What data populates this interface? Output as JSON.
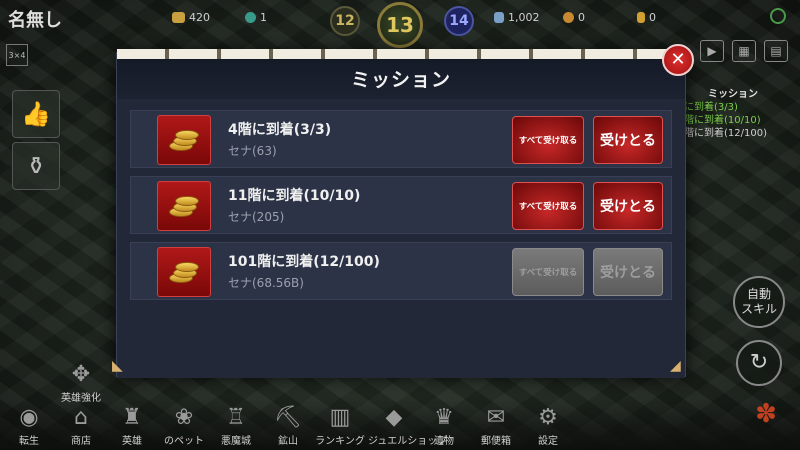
{
  "hud": {
    "player_name": "名無し",
    "gold": "420",
    "gems": "1",
    "floor_prev": "12",
    "floor_current": "13",
    "floor_next": "14",
    "hp": "1,002",
    "sun": "0",
    "crystal": "0"
  },
  "left": {
    "corner_label": "3×4"
  },
  "modal": {
    "title": "ミッション",
    "close_label": "✕",
    "missions": [
      {
        "name": "4階に到着(3/3)",
        "reward": "セナ(63)",
        "claim_all_label": "すべて受け取る",
        "claim_label": "受けとる",
        "enabled": true
      },
      {
        "name": "11階に到着(10/10)",
        "reward": "セナ(205)",
        "claim_all_label": "すべて受け取る",
        "claim_label": "受けとる",
        "enabled": true
      },
      {
        "name": "101階に到着(12/100)",
        "reward": "セナ(68.56B)",
        "claim_all_label": "すべて受け取る",
        "claim_label": "受けとる",
        "enabled": false
      }
    ]
  },
  "bg_mission": {
    "title": "ミッション",
    "line1": "に到着(3/3)",
    "line2": "階に到着(10/10)",
    "line3": "階に到着(12/100)"
  },
  "auto_skill": {
    "line1": "自動",
    "line2": "スキル"
  },
  "hero_boost": {
    "label": "英雄強化"
  },
  "nav": [
    {
      "label": "転生",
      "icon": "rebirth-icon"
    },
    {
      "label": "商店",
      "icon": "shop-icon"
    },
    {
      "label": "英雄",
      "icon": "hero-icon"
    },
    {
      "label": "のペット",
      "icon": "pet-icon"
    },
    {
      "label": "悪魔城",
      "icon": "castle-icon"
    },
    {
      "label": "鉱山",
      "icon": "mine-icon"
    },
    {
      "label": "ランキング",
      "icon": "ranking-icon"
    },
    {
      "label": "ジュエルショップ",
      "icon": "jewel-shop-icon"
    },
    {
      "label": "遺物",
      "icon": "relic-icon"
    },
    {
      "label": "郵便箱",
      "icon": "mailbox-icon"
    },
    {
      "label": "設定",
      "icon": "settings-icon"
    }
  ],
  "colors": {
    "accent_red": "#c82828",
    "modal_bg": "#222838",
    "row_bg": "#2c3346",
    "disabled_gray": "#6a6a6a"
  }
}
